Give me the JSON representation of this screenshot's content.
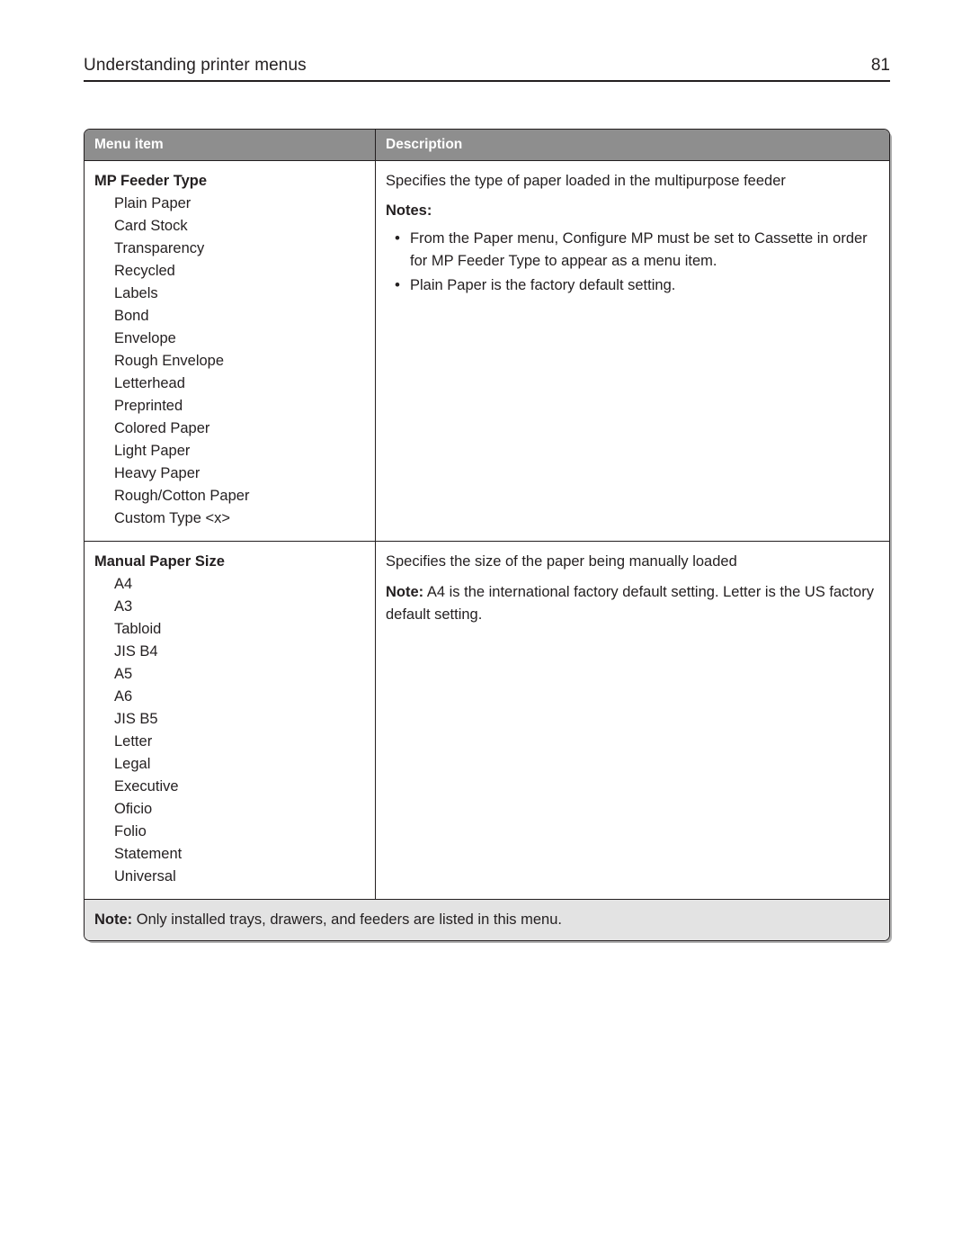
{
  "header": {
    "title": "Understanding printer menus",
    "page_number": "81"
  },
  "table": {
    "columns": {
      "menu_item": "Menu item",
      "description": "Description"
    },
    "rows": [
      {
        "title": "MP Feeder Type",
        "options": [
          "Plain Paper",
          "Card Stock",
          "Transparency",
          "Recycled",
          "Labels",
          "Bond",
          "Envelope",
          "Rough Envelope",
          "Letterhead",
          "Preprinted",
          "Colored Paper",
          "Light Paper",
          "Heavy Paper",
          "Rough/Cotton Paper",
          "Custom Type <x>"
        ],
        "description": "Specifies the type of paper loaded in the multipurpose feeder",
        "notes_label": "Notes:",
        "notes": [
          "From the Paper menu, Configure MP must be set to Cassette in order for MP Feeder Type to appear as a menu item.",
          "Plain Paper is the factory default setting."
        ]
      },
      {
        "title": "Manual Paper Size",
        "options": [
          "A4",
          "A3",
          "Tabloid",
          "JIS B4",
          "A5",
          "A6",
          "JIS B5",
          "Letter",
          "Legal",
          "Executive",
          "Oficio",
          "Folio",
          "Statement",
          "Universal"
        ],
        "description": "Specifies the size of the paper being manually loaded",
        "note_label": "Note:",
        "note_text": " A4 is the international factory default setting. Letter is the US factory default setting."
      }
    ],
    "footnote": {
      "label": "Note:",
      "text": " Only installed trays, drawers, and feeders are listed in this menu."
    }
  },
  "colors": {
    "header_row_bg": "#8e8e8e",
    "footnote_bg": "#e3e3e3",
    "text": "#231f20",
    "border": "#231f20"
  }
}
